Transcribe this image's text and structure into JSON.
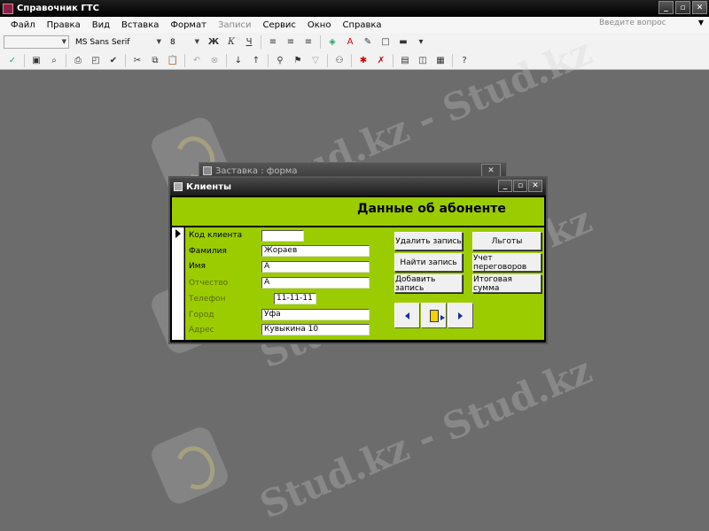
{
  "app": {
    "title": "Справочник ГТС"
  },
  "window_buttons": {
    "minimize": "_",
    "restore": "▫",
    "close": "✕"
  },
  "menu": {
    "items": [
      "Файл",
      "Правка",
      "Вид",
      "Вставка",
      "Формат",
      "Записи",
      "Сервис",
      "Окно",
      "Справка"
    ],
    "ask_placeholder": "Введите вопрос"
  },
  "toolbar": {
    "font_name": "MS Sans Serif",
    "font_size": "8",
    "bold": "Ж",
    "italic": "К",
    "underline": "Ч"
  },
  "watermark": {
    "text": "Stud.kz - Stud.kz"
  },
  "back_form": {
    "title": "Заставка : форма"
  },
  "form": {
    "title": "Клиенты",
    "heading": "Данные об абоненте",
    "fields": [
      {
        "label": "Код клиента",
        "value": ""
      },
      {
        "label": "Фамилия",
        "value": "Жораев"
      },
      {
        "label": "Имя",
        "value": "А"
      },
      {
        "label": "Отчество",
        "value": "А"
      },
      {
        "label": "Телефон",
        "value": "11-11-11"
      },
      {
        "label": "Город",
        "value": "Уфа"
      },
      {
        "label": "Адрес",
        "value": "Кувыкина 10"
      }
    ],
    "buttons": {
      "delete": "Удалить запись",
      "find": "Найти запись",
      "add": "Добавить запись",
      "benefits": "Льготы",
      "calls": "Учет переговоров",
      "total": "Итоговая сумма"
    }
  },
  "colors": {
    "form_bg": "#9bcc00",
    "nav_arrow": "#1a2fa0"
  }
}
